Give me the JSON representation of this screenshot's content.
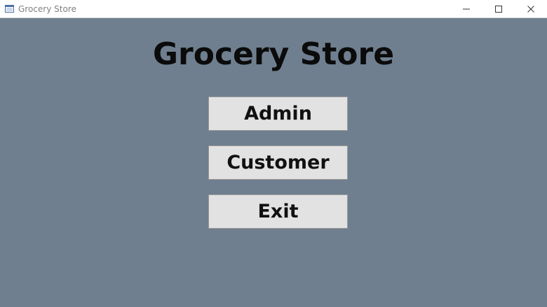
{
  "window": {
    "title": "Grocery Store",
    "icon": "app-window-icon",
    "controls": {
      "minimize_icon": "minimize-icon",
      "maximize_icon": "maximize-icon",
      "close_icon": "close-icon"
    }
  },
  "main": {
    "heading": "Grocery Store",
    "buttons": {
      "admin": "Admin",
      "customer": "Customer",
      "exit": "Exit"
    }
  },
  "colors": {
    "background": "#6f7f8f",
    "button_bg": "#e2e2e2",
    "titlebar_bg": "#ffffff"
  }
}
